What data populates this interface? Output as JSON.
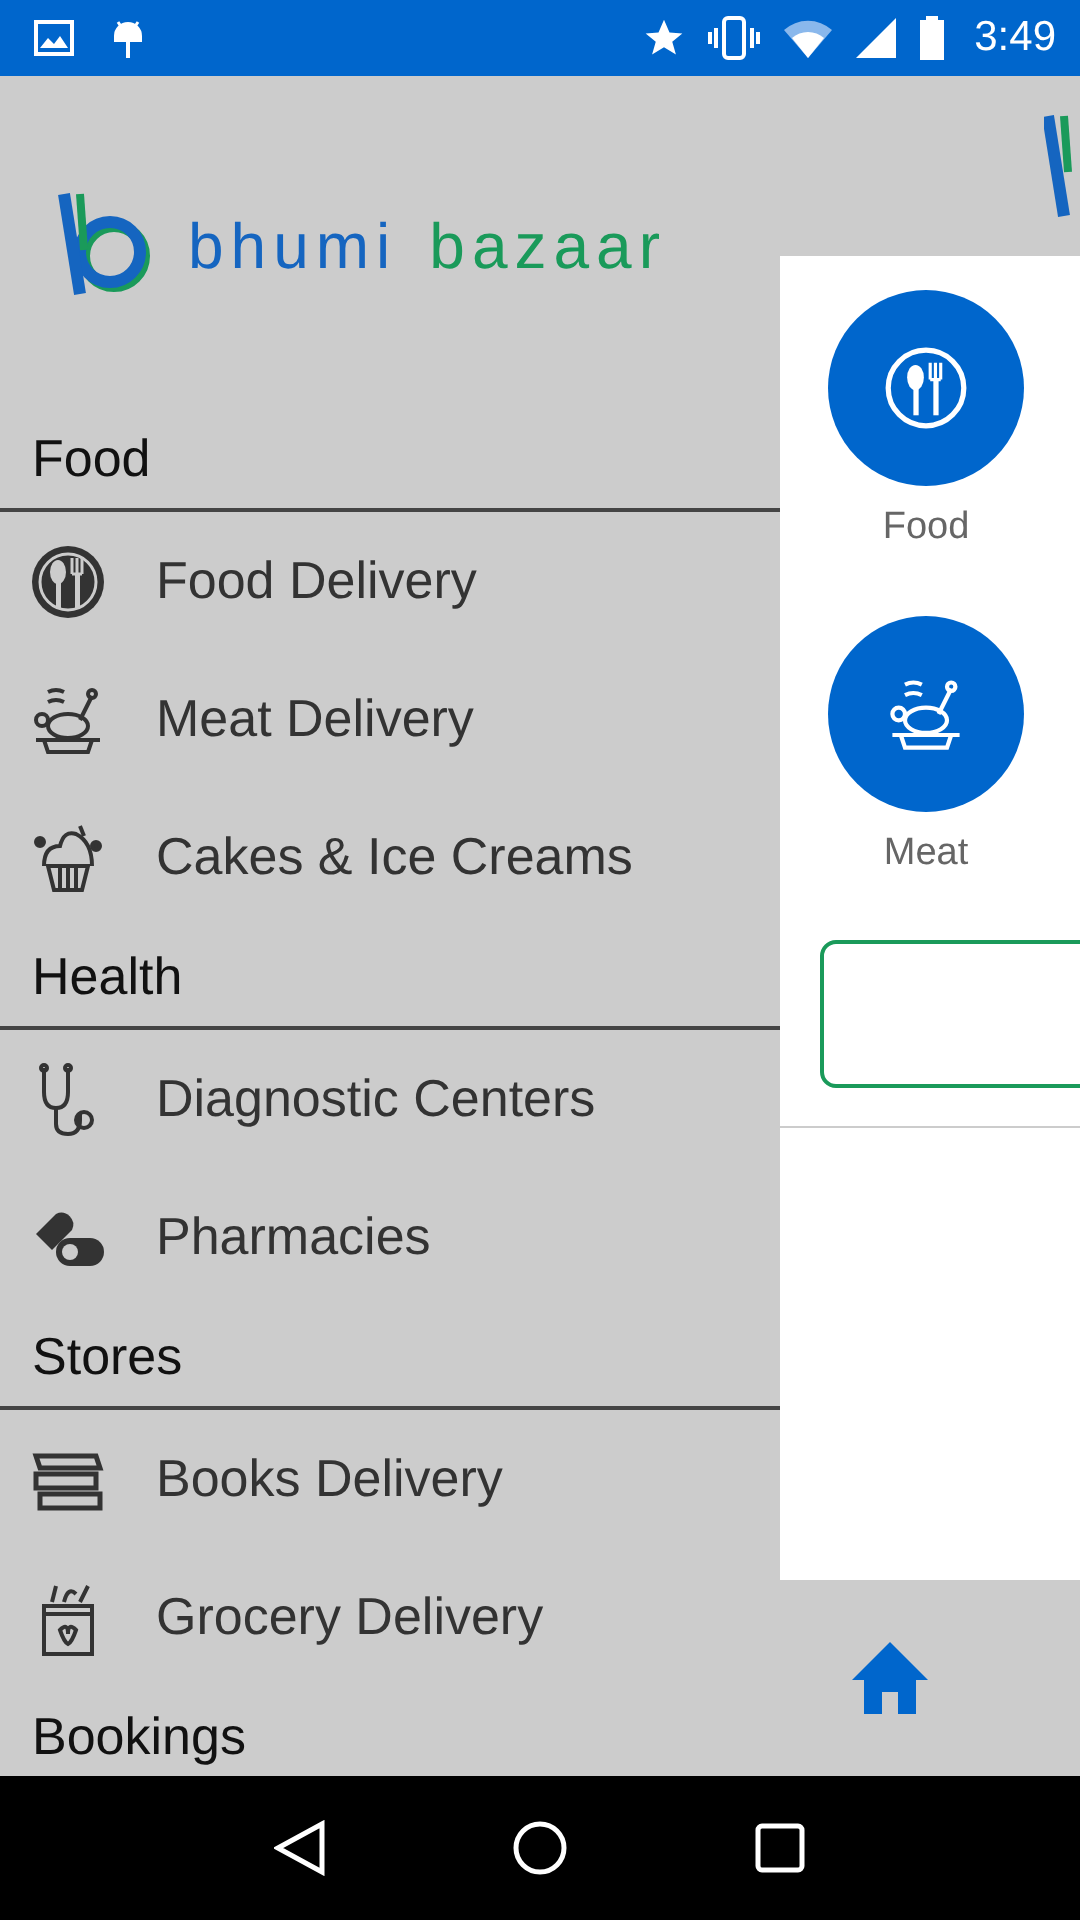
{
  "status_bar": {
    "time": "3:49"
  },
  "drawer": {
    "logo": {
      "first_word": "bhumi",
      "second_word": "bazaar"
    },
    "sections": [
      {
        "title": "Food",
        "items": [
          {
            "label": "Food Delivery",
            "kind": "food"
          },
          {
            "label": "Meat Delivery",
            "kind": "meat"
          },
          {
            "label": "Cakes & Ice Creams",
            "kind": "cake"
          }
        ]
      },
      {
        "title": "Health",
        "items": [
          {
            "label": "Diagnostic Centers",
            "kind": "stethoscope"
          },
          {
            "label": "Pharmacies",
            "kind": "pills"
          }
        ]
      },
      {
        "title": "Stores",
        "items": [
          {
            "label": "Books Delivery",
            "kind": "books"
          },
          {
            "label": "Grocery Delivery",
            "kind": "grocery"
          }
        ]
      },
      {
        "title": "Bookings"
      }
    ]
  },
  "main": {
    "categories": [
      {
        "label": "Food",
        "kind": "food"
      },
      {
        "label": "Meat",
        "kind": "meat"
      }
    ],
    "bottom_nav": [
      {
        "kind": "home",
        "selected": true
      }
    ]
  }
}
